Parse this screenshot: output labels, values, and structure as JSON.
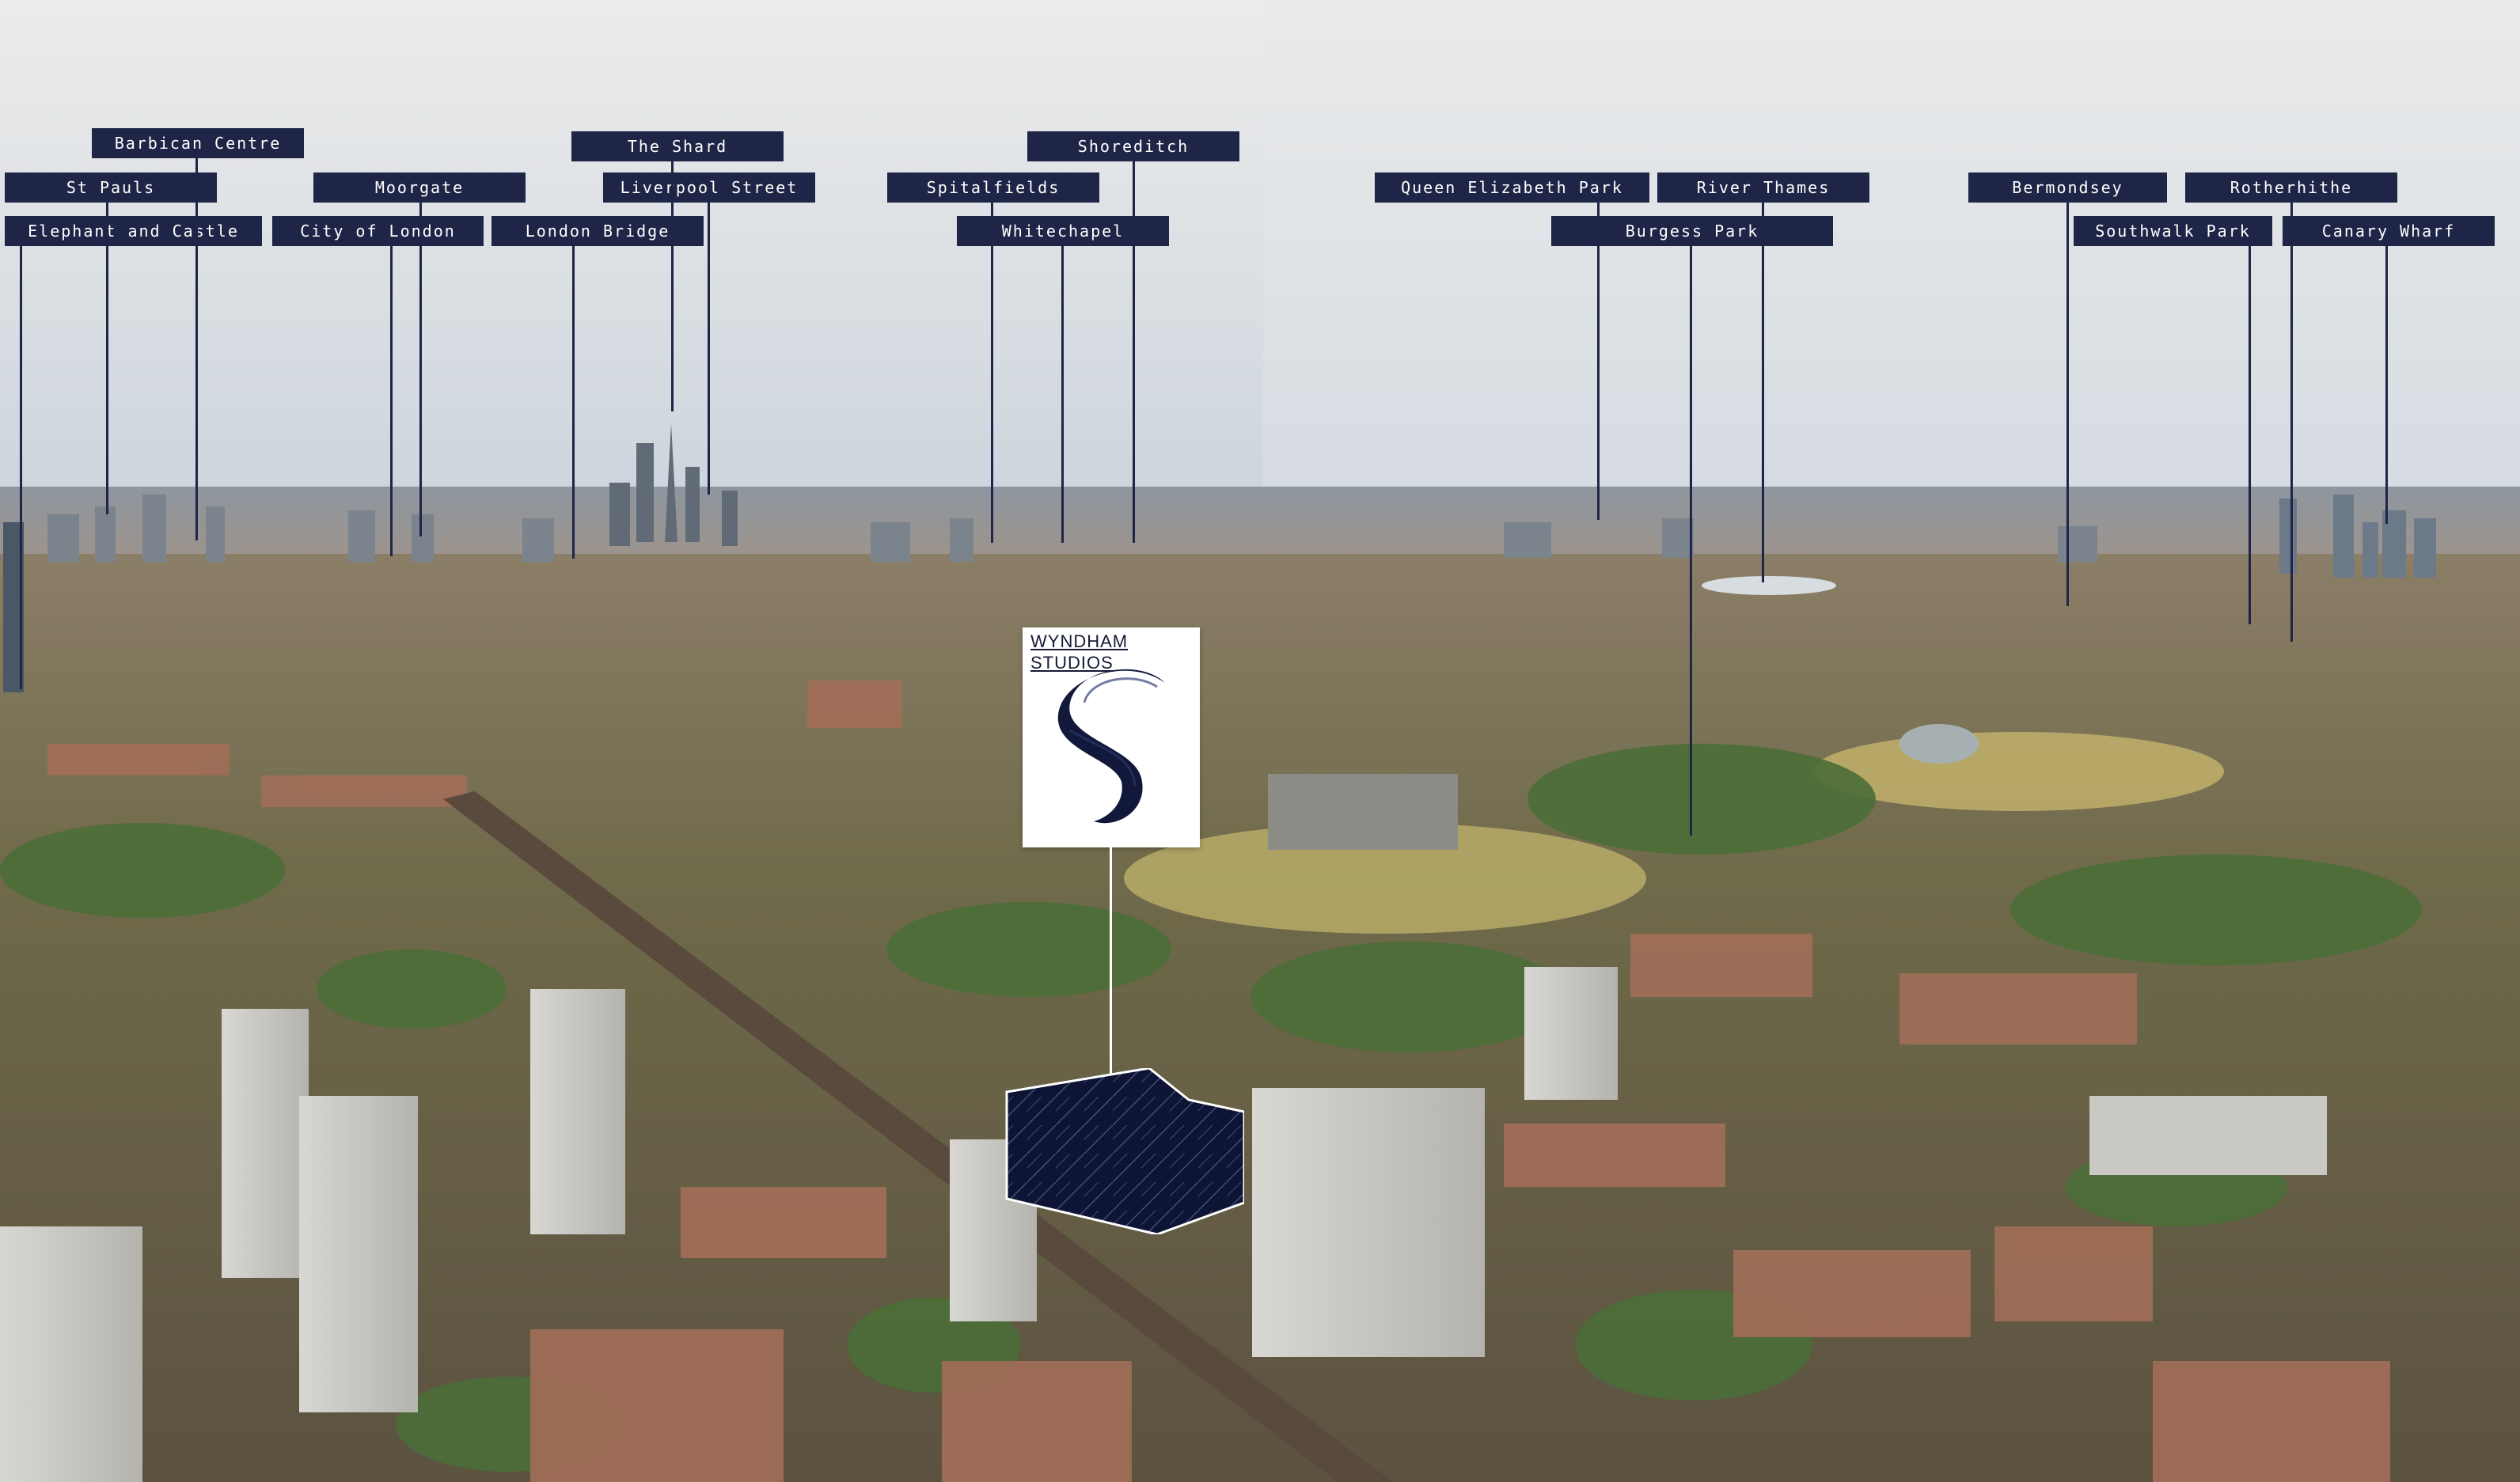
{
  "labels": {
    "barbican_centre": "Barbican Centre",
    "st_pauls": "St Pauls",
    "elephant_and_castle": "Elephant and Castle",
    "moorgate": "Moorgate",
    "city_of_london": "City of London",
    "the_shard": "The Shard",
    "liverpool_street": "Liverpool Street",
    "london_bridge": "London Bridge",
    "spitalfields": "Spitalfields",
    "shoreditch": "Shoreditch",
    "whitechapel": "Whitechapel",
    "queen_elizabeth_park": "Queen Elizabeth Park",
    "river_thames": "River Thames",
    "burgess_park": "Burgess Park",
    "bermondsey": "Bermondsey",
    "rotherhithe": "Rotherhithe",
    "southwalk_park": "Southwalk Park",
    "canary_wharf": "Canary Wharf"
  },
  "logo": {
    "text": "WYNDHAM\nSTUDIOS"
  },
  "colors": {
    "label_bg": "#1f2547",
    "label_text": "#ffffff",
    "sky_top": "#e9eaec",
    "sky_bottom": "#c9d3dc",
    "city_haze": "#9aa1a8",
    "rooftops": "#a26e58",
    "trees": "#4b6e37",
    "park": "#b7ac67"
  }
}
